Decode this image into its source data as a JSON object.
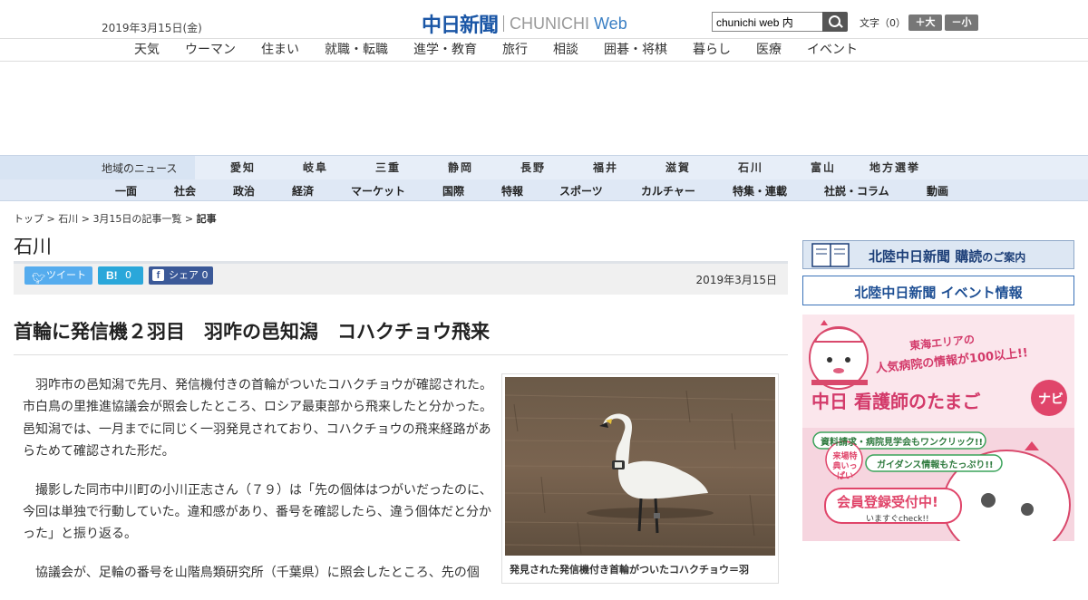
{
  "header": {
    "date": "2019年3月15日(金)",
    "logo_jp": "中日新聞",
    "logo_en": "CHUNICHI",
    "logo_web": "Web",
    "search_value": "chunichi web 内",
    "text_size_label": "文字（0）",
    "text_plus": "＋大",
    "text_minus": "－小"
  },
  "life_nav": [
    "天気",
    "ウーマン",
    "住まい",
    "就職・転職",
    "進学・教育",
    "旅行",
    "相談",
    "囲碁・将棋",
    "暮らし",
    "医療",
    "イベント"
  ],
  "region_nav": {
    "label": "地域のニュース",
    "items": [
      "愛知",
      "岐阜",
      "三重",
      "静岡",
      "長野",
      "福井",
      "滋賀",
      "石川",
      "富山",
      "地方選挙"
    ]
  },
  "category_nav": [
    "一面",
    "社会",
    "政治",
    "経済",
    "マーケット",
    "国際",
    "特報",
    "スポーツ",
    "カルチャー",
    "特集・連載",
    "社説・コラム",
    "動画"
  ],
  "breadcrumb": {
    "top": "トップ",
    "region": "石川",
    "list": "3月15日の記事一覧",
    "current": "記事",
    "sep": " > "
  },
  "section_title": "石川",
  "share": {
    "tweet": "ツイート",
    "hatena_label": "B!",
    "hatena_count": "0",
    "fb_label": "シェア",
    "fb_count": "0"
  },
  "article": {
    "date": "2019年3月15日",
    "headline": "首輪に発信機２羽目　羽咋の邑知潟　コハクチョウ飛来",
    "paragraphs": [
      "羽咋市の邑知潟で先月、発信機付きの首輪がついたコハクチョウが確認された。市白鳥の里推進協議会が照会したところ、ロシア最東部から飛来したと分かった。邑知潟では、一月までに同じく一羽発見されており、コハクチョウの飛来経路があらためて確認された形だ。",
      "撮影した同市中川町の小川正志さん（７９）は「先の個体はつがいだったのに、今回は単独で行動していた。違和感があり、番号を確認したら、違う個体だと分かった」と振り返る。",
      "協議会が、足輪の番号を山階鳥類研究所（千葉県）に照会したところ、先の個"
    ],
    "photo_caption": "発見された発信機付き首輪がついたコハクチョウ＝羽"
  },
  "sidebar": {
    "banner1_main": "北陸中日新聞 購読",
    "banner1_sub": "のご案内",
    "banner2_name": "北陸中日新聞",
    "banner2_label": "イベント情報",
    "ad": {
      "line1": "東海エリアの",
      "line2": "人気病院の情報が100以上!!",
      "title": "中日 看護師のたまご",
      "navi": "ナビ",
      "line3": "資料請求・病院見学会もワンクリック!!",
      "badge": "来場特典いっぱい",
      "line4": "ガイダンス情報もたっぷり!!",
      "cta": "会員登録受付中!",
      "cta_sub": "いますぐcheck!!"
    }
  }
}
